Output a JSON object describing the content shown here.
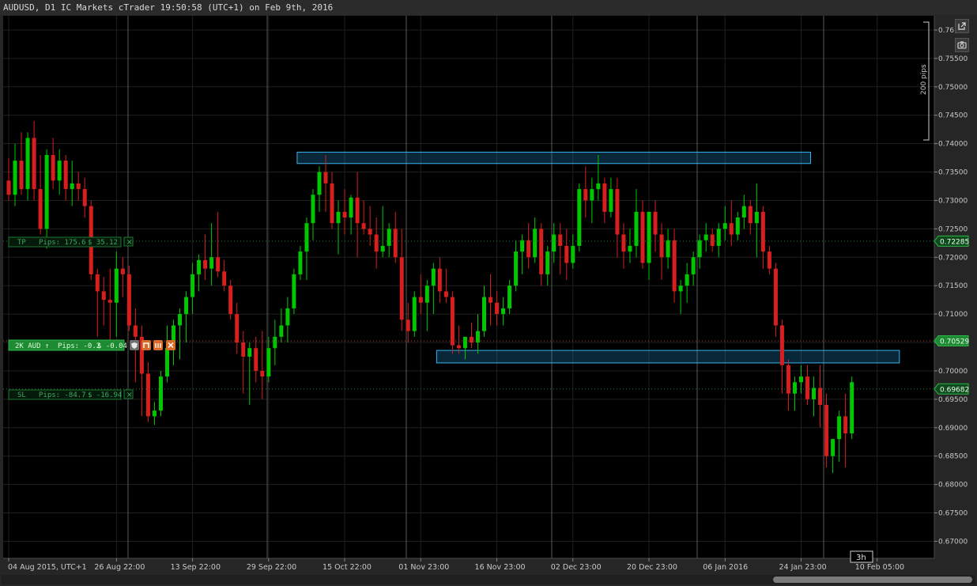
{
  "header": {
    "title": "AUDUSD, D1 IC Markets cTrader 19:50:58 (UTC+1) on Feb 9th, 2016"
  },
  "toolbar": {
    "detach_icon": "external-link-icon",
    "screenshot_icon": "camera-icon"
  },
  "colors": {
    "bull": "#00c800",
    "bear": "#d81e1e",
    "zone": "#38b4f0",
    "position_green": "#20a838",
    "background": "#000000",
    "grid": "#202020"
  },
  "scale_bar": {
    "label": "200 pips"
  },
  "time_cursor": {
    "label": "3h"
  },
  "orders": {
    "tp": {
      "tag": "TP",
      "pips": "Pips: 175.6",
      "money": "$ 35.12"
    },
    "position": {
      "tag": "2K AUD ↑",
      "pips": "Pips: -0.2",
      "money": "$ -0.04"
    },
    "sl": {
      "tag": "SL",
      "pips": "Pips: -84.7",
      "money": "$ -16.94"
    },
    "close_glyph": "×"
  },
  "chart_data": {
    "type": "candlestick",
    "symbol": "AUDUSD",
    "timeframe": "D1",
    "ylim": [
      0.667,
      0.7625
    ],
    "y_ticks": [
      0.67,
      0.675,
      0.68,
      0.685,
      0.69,
      0.695,
      0.7,
      0.705,
      0.71,
      0.715,
      0.72,
      0.725,
      0.73,
      0.735,
      0.74,
      0.745,
      0.75,
      0.755,
      0.76
    ],
    "y_tick_labels": [
      "0.67000",
      "0.67500",
      "0.68000",
      "0.68500",
      "0.69000",
      "0.69500",
      "0.70000",
      "0.70500",
      "0.71000",
      "0.71500",
      "0.72000",
      "0.72500",
      "0.73000",
      "0.73500",
      "0.74000",
      "0.74500",
      "0.75000",
      "0.75500",
      "0.76"
    ],
    "x_labels": [
      {
        "index": 0,
        "label": "04 Aug 2015, UTC+1"
      },
      {
        "index": 17,
        "label": "26 Aug 22:00"
      },
      {
        "index": 29,
        "label": "13 Sep 22:00"
      },
      {
        "index": 41,
        "label": "29 Sep 22:00"
      },
      {
        "index": 53,
        "label": "15 Oct 22:00"
      },
      {
        "index": 65,
        "label": "01 Nov 23:00"
      },
      {
        "index": 77,
        "label": "16 Nov 23:00"
      },
      {
        "index": 89,
        "label": "02 Dec 23:00"
      },
      {
        "index": 101,
        "label": "20 Dec 23:00"
      },
      {
        "index": 113,
        "label": "06 Jan 2016"
      },
      {
        "index": 125,
        "label": "24 Jan 23:00"
      },
      {
        "index": 137,
        "label": "10 Feb 05:00"
      }
    ],
    "price_tags": [
      {
        "name": "take-profit",
        "value": 0.72285,
        "label": "0.72285"
      },
      {
        "name": "current-price",
        "value": 0.70529,
        "label": "0.70529"
      },
      {
        "name": "stop-loss",
        "value": 0.69682,
        "label": "0.69682"
      }
    ],
    "zones": [
      {
        "name": "resistance-zone",
        "from_index": 46,
        "to_index": 126,
        "top": 0.7385,
        "bottom": 0.7365
      },
      {
        "name": "support-zone",
        "from_index": 68,
        "to_index": 140,
        "top": 0.7036,
        "bottom": 0.7014
      }
    ],
    "candles": [
      [
        0.7335,
        0.7375,
        0.73,
        0.731
      ],
      [
        0.731,
        0.74,
        0.729,
        0.737
      ],
      [
        0.737,
        0.742,
        0.731,
        0.732
      ],
      [
        0.732,
        0.742,
        0.73,
        0.741
      ],
      [
        0.741,
        0.744,
        0.73,
        0.732
      ],
      [
        0.732,
        0.738,
        0.724,
        0.725
      ],
      [
        0.725,
        0.739,
        0.7215,
        0.738
      ],
      [
        0.738,
        0.741,
        0.732,
        0.7335
      ],
      [
        0.7335,
        0.739,
        0.731,
        0.737
      ],
      [
        0.737,
        0.738,
        0.73,
        0.732
      ],
      [
        0.732,
        0.737,
        0.729,
        0.733
      ],
      [
        0.733,
        0.735,
        0.73,
        0.732
      ],
      [
        0.732,
        0.734,
        0.727,
        0.729
      ],
      [
        0.729,
        0.73,
        0.716,
        0.717
      ],
      [
        0.717,
        0.718,
        0.706,
        0.714
      ],
      [
        0.714,
        0.7165,
        0.708,
        0.7125
      ],
      [
        0.7125,
        0.718,
        0.705,
        0.712
      ],
      [
        0.712,
        0.721,
        0.706,
        0.718
      ],
      [
        0.718,
        0.72,
        0.713,
        0.717
      ],
      [
        0.717,
        0.7185,
        0.707,
        0.708
      ],
      [
        0.708,
        0.711,
        0.698,
        0.706
      ],
      [
        0.706,
        0.708,
        0.692,
        0.6995
      ],
      [
        0.6995,
        0.7015,
        0.691,
        0.692
      ],
      [
        0.692,
        0.6945,
        0.6905,
        0.693
      ],
      [
        0.693,
        0.7,
        0.692,
        0.699
      ],
      [
        0.699,
        0.708,
        0.698,
        0.704
      ],
      [
        0.704,
        0.709,
        0.701,
        0.708
      ],
      [
        0.708,
        0.711,
        0.702,
        0.71
      ],
      [
        0.71,
        0.714,
        0.705,
        0.713
      ],
      [
        0.713,
        0.719,
        0.71,
        0.717
      ],
      [
        0.717,
        0.7205,
        0.714,
        0.7195
      ],
      [
        0.7195,
        0.724,
        0.716,
        0.718
      ],
      [
        0.718,
        0.726,
        0.715,
        0.72
      ],
      [
        0.72,
        0.728,
        0.7165,
        0.7175
      ],
      [
        0.7175,
        0.7195,
        0.714,
        0.715
      ],
      [
        0.715,
        0.716,
        0.709,
        0.71
      ],
      [
        0.71,
        0.712,
        0.703,
        0.705
      ],
      [
        0.705,
        0.707,
        0.696,
        0.7025
      ],
      [
        0.7025,
        0.705,
        0.694,
        0.704
      ],
      [
        0.704,
        0.706,
        0.698,
        0.7
      ],
      [
        0.7,
        0.707,
        0.695,
        0.699
      ],
      [
        0.699,
        0.706,
        0.698,
        0.704
      ],
      [
        0.704,
        0.709,
        0.701,
        0.706
      ],
      [
        0.706,
        0.711,
        0.705,
        0.708
      ],
      [
        0.708,
        0.713,
        0.705,
        0.711
      ],
      [
        0.711,
        0.718,
        0.71,
        0.717
      ],
      [
        0.717,
        0.722,
        0.716,
        0.721
      ],
      [
        0.721,
        0.727,
        0.716,
        0.726
      ],
      [
        0.726,
        0.732,
        0.723,
        0.731
      ],
      [
        0.731,
        0.736,
        0.728,
        0.735
      ],
      [
        0.735,
        0.738,
        0.728,
        0.733
      ],
      [
        0.733,
        0.735,
        0.725,
        0.726
      ],
      [
        0.726,
        0.73,
        0.7205,
        0.728
      ],
      [
        0.728,
        0.732,
        0.724,
        0.727
      ],
      [
        0.727,
        0.731,
        0.724,
        0.7305
      ],
      [
        0.7305,
        0.735,
        0.72,
        0.726
      ],
      [
        0.726,
        0.73,
        0.724,
        0.725
      ],
      [
        0.725,
        0.729,
        0.722,
        0.724
      ],
      [
        0.724,
        0.727,
        0.718,
        0.721
      ],
      [
        0.721,
        0.729,
        0.72,
        0.722
      ],
      [
        0.722,
        0.726,
        0.72,
        0.725
      ],
      [
        0.725,
        0.728,
        0.719,
        0.72
      ],
      [
        0.72,
        0.725,
        0.707,
        0.709
      ],
      [
        0.709,
        0.712,
        0.705,
        0.707
      ],
      [
        0.707,
        0.714,
        0.706,
        0.713
      ],
      [
        0.713,
        0.717,
        0.71,
        0.712
      ],
      [
        0.712,
        0.716,
        0.707,
        0.715
      ],
      [
        0.715,
        0.719,
        0.71,
        0.718
      ],
      [
        0.718,
        0.72,
        0.712,
        0.714
      ],
      [
        0.714,
        0.718,
        0.712,
        0.713
      ],
      [
        0.713,
        0.714,
        0.703,
        0.7045
      ],
      [
        0.7045,
        0.708,
        0.703,
        0.704
      ],
      [
        0.704,
        0.706,
        0.702,
        0.706
      ],
      [
        0.706,
        0.7085,
        0.704,
        0.705
      ],
      [
        0.705,
        0.71,
        0.703,
        0.707
      ],
      [
        0.707,
        0.715,
        0.706,
        0.713
      ],
      [
        0.713,
        0.717,
        0.708,
        0.712
      ],
      [
        0.712,
        0.714,
        0.708,
        0.71
      ],
      [
        0.71,
        0.713,
        0.708,
        0.711
      ],
      [
        0.711,
        0.716,
        0.71,
        0.715
      ],
      [
        0.715,
        0.723,
        0.714,
        0.721
      ],
      [
        0.721,
        0.724,
        0.717,
        0.723
      ],
      [
        0.723,
        0.726,
        0.718,
        0.72
      ],
      [
        0.72,
        0.727,
        0.719,
        0.725
      ],
      [
        0.725,
        0.726,
        0.715,
        0.717
      ],
      [
        0.717,
        0.722,
        0.715,
        0.721
      ],
      [
        0.721,
        0.726,
        0.719,
        0.724
      ],
      [
        0.724,
        0.726,
        0.717,
        0.722
      ],
      [
        0.722,
        0.725,
        0.716,
        0.719
      ],
      [
        0.719,
        0.724,
        0.718,
        0.722
      ],
      [
        0.722,
        0.733,
        0.721,
        0.732
      ],
      [
        0.732,
        0.736,
        0.727,
        0.73
      ],
      [
        0.73,
        0.734,
        0.726,
        0.732
      ],
      [
        0.732,
        0.738,
        0.73,
        0.733
      ],
      [
        0.733,
        0.734,
        0.726,
        0.728
      ],
      [
        0.728,
        0.734,
        0.727,
        0.732
      ],
      [
        0.732,
        0.734,
        0.72,
        0.724
      ],
      [
        0.724,
        0.726,
        0.718,
        0.721
      ],
      [
        0.721,
        0.725,
        0.719,
        0.722
      ],
      [
        0.722,
        0.732,
        0.72,
        0.728
      ],
      [
        0.728,
        0.73,
        0.718,
        0.719
      ],
      [
        0.719,
        0.728,
        0.716,
        0.728
      ],
      [
        0.728,
        0.73,
        0.721,
        0.724
      ],
      [
        0.724,
        0.726,
        0.716,
        0.72
      ],
      [
        0.72,
        0.725,
        0.718,
        0.723
      ],
      [
        0.723,
        0.725,
        0.712,
        0.714
      ],
      [
        0.714,
        0.716,
        0.71,
        0.715
      ],
      [
        0.715,
        0.719,
        0.712,
        0.717
      ],
      [
        0.717,
        0.721,
        0.715,
        0.72
      ],
      [
        0.72,
        0.724,
        0.718,
        0.723
      ],
      [
        0.723,
        0.726,
        0.721,
        0.724
      ],
      [
        0.724,
        0.725,
        0.721,
        0.722
      ],
      [
        0.722,
        0.726,
        0.72,
        0.725
      ],
      [
        0.725,
        0.729,
        0.723,
        0.726
      ],
      [
        0.726,
        0.73,
        0.722,
        0.724
      ],
      [
        0.724,
        0.728,
        0.723,
        0.727
      ],
      [
        0.727,
        0.731,
        0.725,
        0.729
      ],
      [
        0.729,
        0.73,
        0.724,
        0.726
      ],
      [
        0.726,
        0.733,
        0.72,
        0.728
      ],
      [
        0.728,
        0.729,
        0.718,
        0.721
      ],
      [
        0.721,
        0.722,
        0.717,
        0.718
      ],
      [
        0.718,
        0.719,
        0.706,
        0.708
      ],
      [
        0.708,
        0.709,
        0.696,
        0.701
      ],
      [
        0.701,
        0.702,
        0.693,
        0.696
      ],
      [
        0.696,
        0.699,
        0.693,
        0.698
      ],
      [
        0.698,
        0.701,
        0.696,
        0.699
      ],
      [
        0.699,
        0.701,
        0.694,
        0.695
      ],
      [
        0.695,
        0.699,
        0.692,
        0.697
      ],
      [
        0.697,
        0.701,
        0.69,
        0.694
      ],
      [
        0.694,
        0.696,
        0.683,
        0.685
      ],
      [
        0.685,
        0.688,
        0.682,
        0.688
      ],
      [
        0.688,
        0.693,
        0.684,
        0.692
      ],
      [
        0.692,
        0.696,
        0.683,
        0.689
      ],
      [
        0.689,
        0.699,
        0.688,
        0.698
      ]
    ]
  }
}
